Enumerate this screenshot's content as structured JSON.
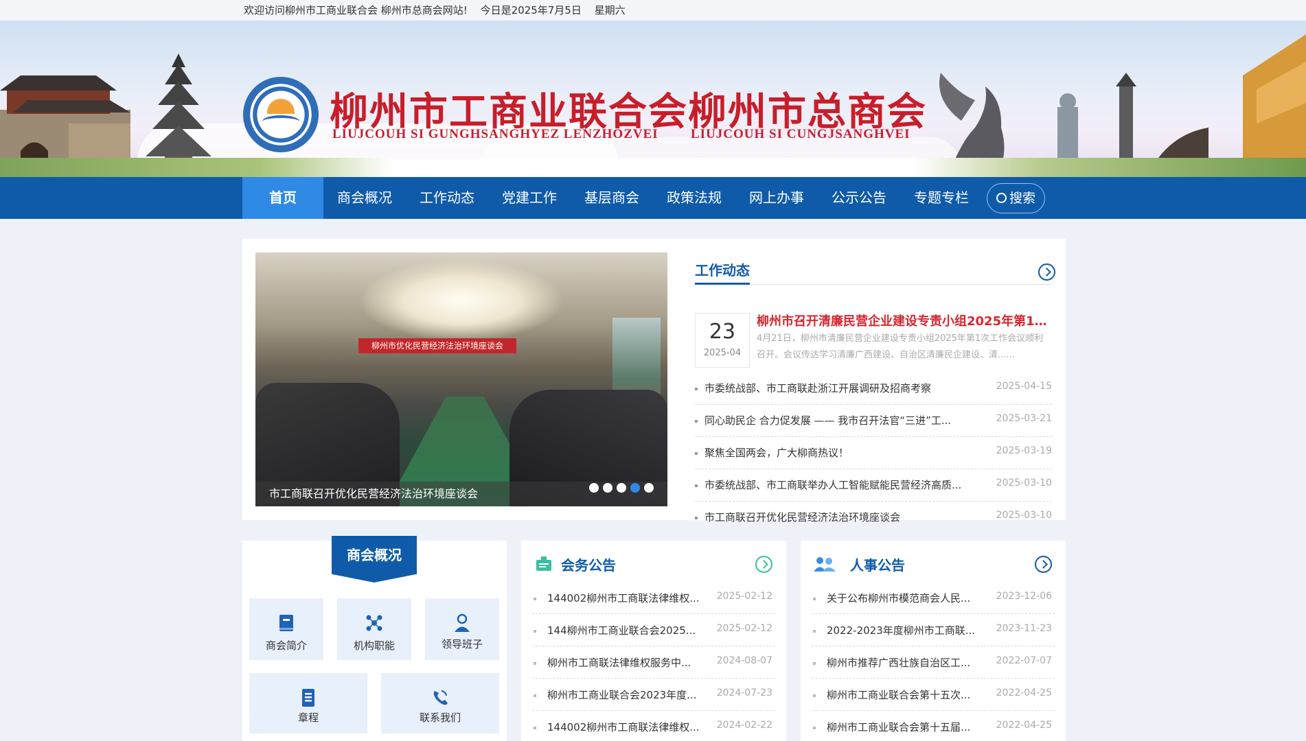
{
  "topbar": {
    "welcome": "欢迎访问柳州市工商业联合会 柳州市总商会网站!",
    "today": "今日是2025年7月5日",
    "weekday": "星期六"
  },
  "header": {
    "title_cn_1": "柳州市工商业联合会",
    "title_en_1": "LIUJCOUH SI GUNGHSANGHYEZ LENZHOZVEI",
    "title_cn_2": "柳州市总商会",
    "title_en_2": "LIUJCOUH SI CUNGJSANGHVEI",
    "logo_alt": "logo-emblem"
  },
  "nav": {
    "items": [
      "首页",
      "商会概况",
      "工作动态",
      "党建工作",
      "基层商会",
      "政策法规",
      "网上办事",
      "公示公告",
      "专题专栏"
    ],
    "active_index": 0,
    "search_label": "搜索"
  },
  "slider": {
    "caption": "市工商联召开优化民营经济法治环境座谈会",
    "banner_text": "柳州市优化民营经济法治环境座谈会",
    "dot_count": 5,
    "active_dot": 3
  },
  "work_news": {
    "title": "工作动态",
    "feature": {
      "day": "23",
      "year_month": "2025-04",
      "title": "柳州市召开清廉民营企业建设专责小组2025年第1次...",
      "desc": "4月21日，柳州市清廉民营企业建设专责小组2025年第1次工作会议顺利召开。会议传达学习清廉广西建设、自治区清廉民企建设、清......"
    },
    "items": [
      {
        "title": "市委统战部、市工商联赴浙江开展调研及招商考察",
        "date": "2025-04-15"
      },
      {
        "title": "同心助民企 合力促发展 —— 我市召开法官“三进”工...",
        "date": "2025-03-21"
      },
      {
        "title": "聚焦全国两会，广大柳商热议！",
        "date": "2025-03-19"
      },
      {
        "title": "市委统战部、市工商联举办人工智能赋能民营经济高质...",
        "date": "2025-03-10"
      },
      {
        "title": "市工商联召开优化民营经济法治环境座谈会",
        "date": "2025-03-10"
      }
    ]
  },
  "overview": {
    "title": "商会概况",
    "tiles": [
      {
        "label": "商会简介",
        "icon": "book-icon"
      },
      {
        "label": "机构职能",
        "icon": "org-icon"
      },
      {
        "label": "领导班子",
        "icon": "leader-icon"
      },
      {
        "label": "章程",
        "icon": "document-icon"
      },
      {
        "label": "联系我们",
        "icon": "phone-icon"
      }
    ]
  },
  "meeting_notice": {
    "title": "会务公告",
    "items": [
      {
        "title": "144002柳州市工商联法律维权...",
        "date": "2025-02-12"
      },
      {
        "title": "144柳州市工商业联合会2025...",
        "date": "2025-02-12"
      },
      {
        "title": "柳州市工商联法律维权服务中...",
        "date": "2024-08-07"
      },
      {
        "title": "柳州市工商业联合会2023年度...",
        "date": "2024-07-23"
      },
      {
        "title": "144002柳州市工商联法律维权...",
        "date": "2024-02-22"
      }
    ]
  },
  "personnel_notice": {
    "title": "人事公告",
    "items": [
      {
        "title": "关于公布柳州市模范商会人民...",
        "date": "2023-12-06"
      },
      {
        "title": "2022-2023年度柳州市工商联...",
        "date": "2023-11-23"
      },
      {
        "title": "柳州市推荐广西壮族自治区工...",
        "date": "2022-07-07"
      },
      {
        "title": "柳州市工商业联合会第十五次...",
        "date": "2022-04-25"
      },
      {
        "title": "柳州市工商业联合会第十五届...",
        "date": "2022-04-25"
      }
    ]
  },
  "colors": {
    "brand_blue": "#0f5baa",
    "nav_active": "#2f8ae6",
    "title_red": "#c81e2a",
    "teal": "#3bbfa0"
  }
}
